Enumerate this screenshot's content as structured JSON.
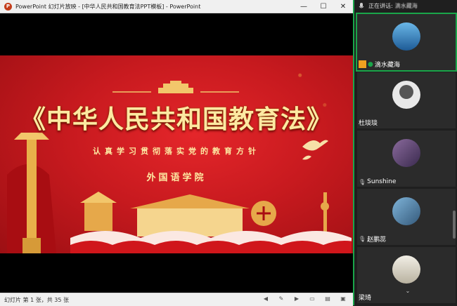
{
  "window": {
    "app_icon_letter": "P",
    "title": "PowerPoint 幻灯片放映 - [中华人民共和国教育法PPT模板] - PowerPoint",
    "controls": [
      "—",
      "☐",
      "✕"
    ]
  },
  "slide": {
    "title": "《中华人民共和国教育法》",
    "subtitle": "认真学习贯彻落实党的教育方针",
    "school": "外国语学院"
  },
  "statusbar": {
    "text": "幻灯片 第 1 张，共 35 张"
  },
  "meeting": {
    "speaking_label": "正在讲话:",
    "speaking_name": "滴水藏海",
    "participants": [
      {
        "name": "滴水藏海",
        "mic": "on",
        "host": true
      },
      {
        "name": "杜琰琰",
        "mic": "none"
      },
      {
        "name": "Sunshine",
        "mic": "off"
      },
      {
        "name": "赵鹏蕊",
        "mic": "off"
      },
      {
        "name": "梁琦",
        "mic": "none"
      }
    ],
    "scroll_down": "⌄"
  },
  "colors": {
    "slide_red": "#c81a1f",
    "gold_text": "#fde9a2",
    "active_green": "#1aa64a",
    "ppt_orange": "#c43e1c"
  }
}
